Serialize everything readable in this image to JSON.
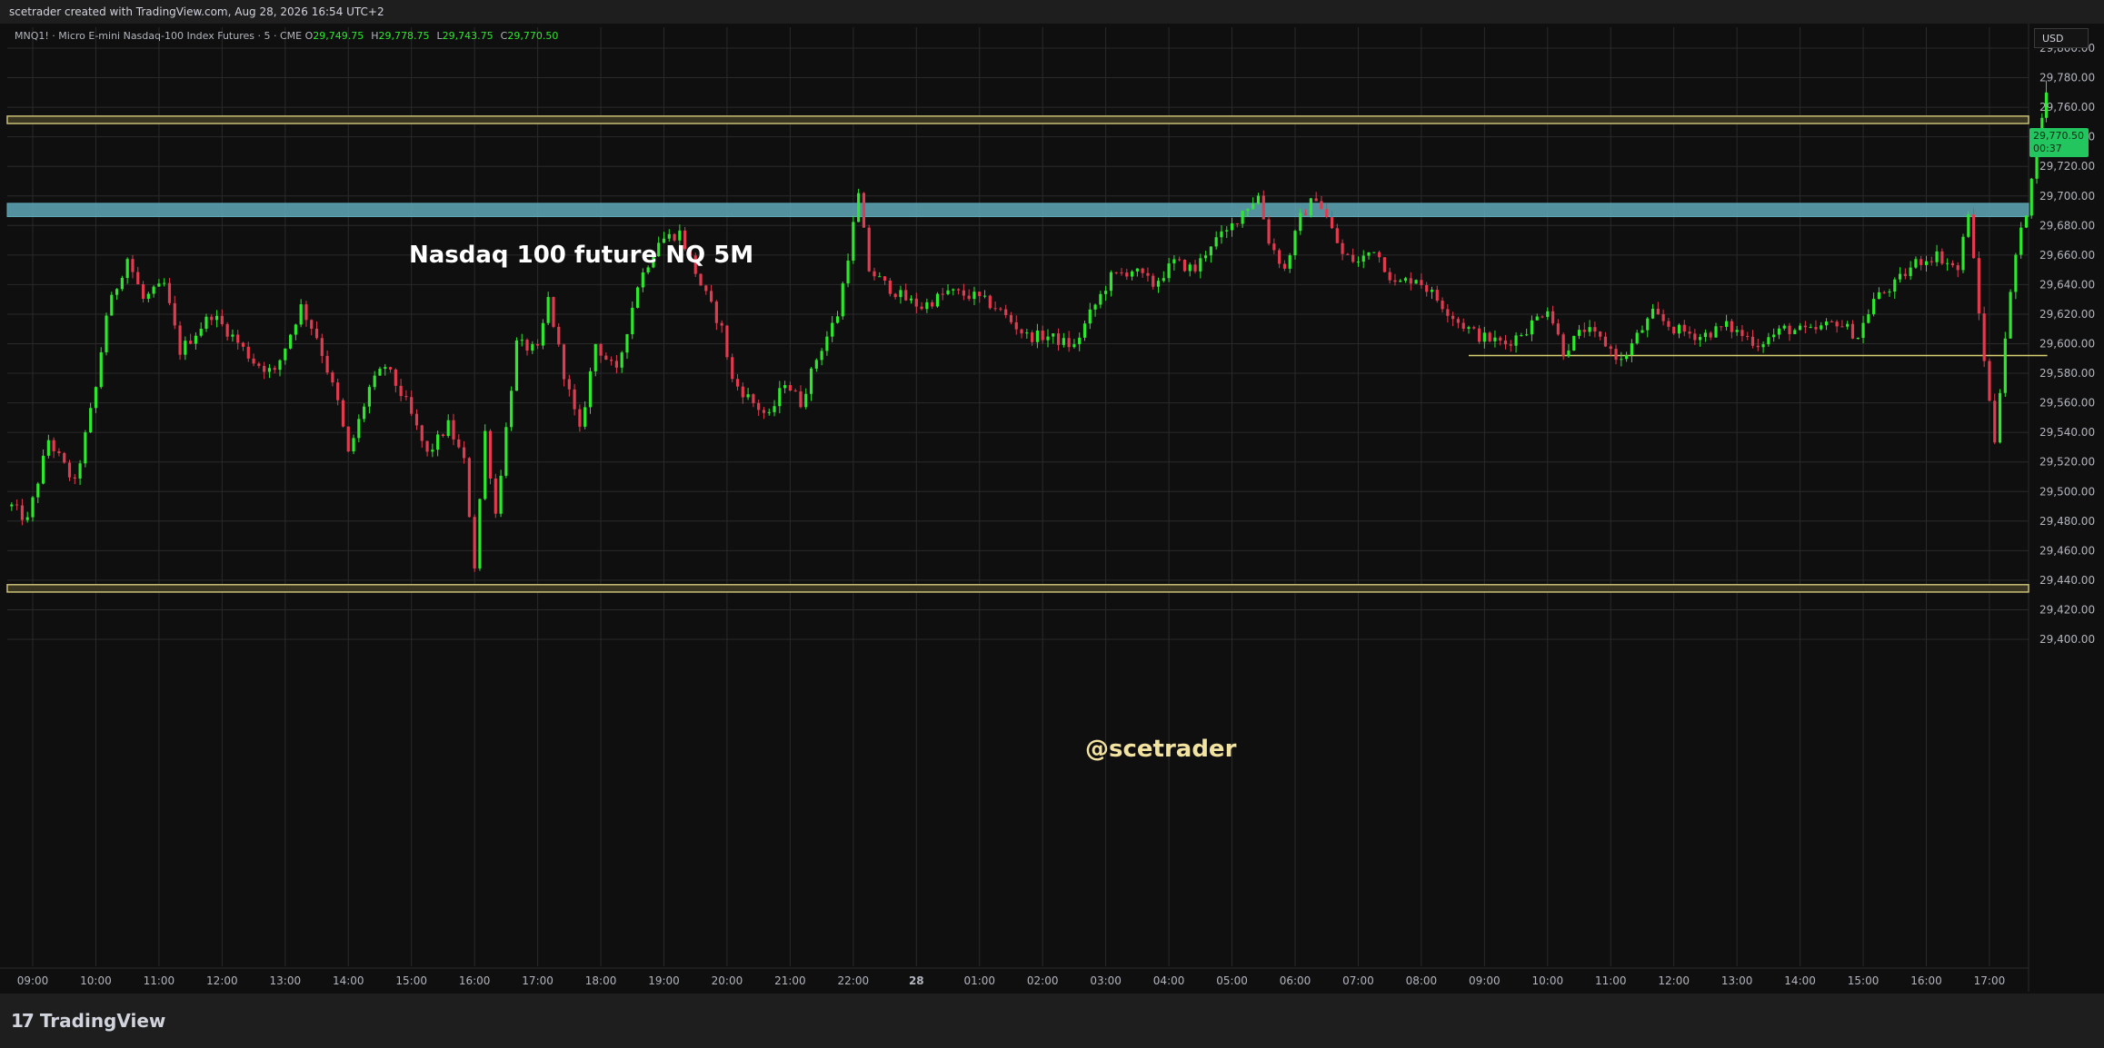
{
  "header": {
    "creator_line": "scetrader created with TradingView.com, Aug 28, 2026 16:54 UTC+2"
  },
  "symbol_legend": {
    "name": "MNQ1! · Micro E-mini Nasdaq-100 Index Futures · 5 · CME",
    "open_label": "O",
    "open": "29,749.75",
    "high_label": "H",
    "high": "29,778.75",
    "low_label": "L",
    "low": "29,743.75",
    "close_label": "C",
    "close": "29,770.50"
  },
  "currency_button": "USD",
  "last_price": {
    "price": "29,770.50",
    "countdown": "00:37"
  },
  "brand": "TradingView",
  "colors": {
    "bull": "#2ee82e",
    "bear": "#e23b4f",
    "background": "#0f0f0f",
    "grid": "#2a2a2a",
    "axis_text": "#b2b5be",
    "resistance_zone": "#5fa8b8",
    "level_band": "#c9bf76",
    "support_line": "#d8d070",
    "annotation_title": "#ffffff",
    "annotation_watermark": "#f3e3a0"
  },
  "chart_data": {
    "type": "candlestick",
    "title": "Nasdaq 100 future NQ 5M",
    "watermark": "@scetrader",
    "timeframe_minutes": 5,
    "y_axis": {
      "ylim": [
        29393,
        29820
      ],
      "ticks": [
        "29,800.00",
        "29,780.00",
        "29,760.00",
        "29,740.00",
        "29,720.00",
        "29,700.00",
        "29,680.00",
        "29,660.00",
        "29,640.00",
        "29,620.00",
        "29,600.00",
        "29,580.00",
        "29,560.00",
        "29,540.00",
        "29,520.00",
        "29,500.00",
        "29,480.00",
        "29,460.00",
        "29,440.00",
        "29,420.00",
        "29,400.00"
      ]
    },
    "x_axis": {
      "ticks": [
        "09:00",
        "10:00",
        "11:00",
        "12:00",
        "13:00",
        "14:00",
        "15:00",
        "16:00",
        "17:00",
        "18:00",
        "19:00",
        "20:00",
        "21:00",
        "22:00",
        "28",
        "01:00",
        "02:00",
        "03:00",
        "04:00",
        "05:00",
        "06:00",
        "07:00",
        "08:00",
        "09:00",
        "10:00",
        "11:00",
        "12:00",
        "13:00",
        "14:00",
        "15:00",
        "16:00",
        "17:00"
      ]
    },
    "horizontal_zones": [
      {
        "name": "upper-band",
        "low": 29749,
        "high": 29754,
        "style": "band"
      },
      {
        "name": "resistance-zone",
        "low": 29686,
        "high": 29695,
        "style": "zone"
      },
      {
        "name": "lower-band",
        "low": 29432,
        "high": 29437,
        "style": "band"
      }
    ],
    "support_line": {
      "price": 29592,
      "from": "07:45",
      "to": "16:55"
    },
    "price_path": [
      {
        "t": "08:40",
        "p": 29490
      },
      {
        "t": "08:55",
        "p": 29480
      },
      {
        "t": "09:15",
        "p": 29535
      },
      {
        "t": "09:40",
        "p": 29505
      },
      {
        "t": "10:00",
        "p": 29570
      },
      {
        "t": "10:10",
        "p": 29620
      },
      {
        "t": "10:30",
        "p": 29658
      },
      {
        "t": "10:45",
        "p": 29630
      },
      {
        "t": "11:05",
        "p": 29640
      },
      {
        "t": "11:20",
        "p": 29595
      },
      {
        "t": "11:50",
        "p": 29620
      },
      {
        "t": "12:10",
        "p": 29605
      },
      {
        "t": "12:30",
        "p": 29588
      },
      {
        "t": "12:50",
        "p": 29580
      },
      {
        "t": "13:15",
        "p": 29625
      },
      {
        "t": "13:30",
        "p": 29605
      },
      {
        "t": "13:50",
        "p": 29560
      },
      {
        "t": "14:00",
        "p": 29525
      },
      {
        "t": "14:20",
        "p": 29570
      },
      {
        "t": "14:35",
        "p": 29585
      },
      {
        "t": "14:55",
        "p": 29560
      },
      {
        "t": "15:15",
        "p": 29525
      },
      {
        "t": "15:35",
        "p": 29545
      },
      {
        "t": "15:50",
        "p": 29520
      },
      {
        "t": "16:00",
        "p": 29450
      },
      {
        "t": "16:10",
        "p": 29540
      },
      {
        "t": "16:20",
        "p": 29485
      },
      {
        "t": "16:40",
        "p": 29600
      },
      {
        "t": "17:00",
        "p": 29595
      },
      {
        "t": "17:10",
        "p": 29630
      },
      {
        "t": "17:25",
        "p": 29580
      },
      {
        "t": "17:40",
        "p": 29540
      },
      {
        "t": "17:55",
        "p": 29600
      },
      {
        "t": "18:15",
        "p": 29580
      },
      {
        "t": "18:35",
        "p": 29640
      },
      {
        "t": "18:55",
        "p": 29670
      },
      {
        "t": "19:15",
        "p": 29675
      },
      {
        "t": "19:35",
        "p": 29640
      },
      {
        "t": "19:55",
        "p": 29610
      },
      {
        "t": "20:05",
        "p": 29575
      },
      {
        "t": "20:25",
        "p": 29560
      },
      {
        "t": "20:40",
        "p": 29550
      },
      {
        "t": "20:55",
        "p": 29575
      },
      {
        "t": "21:10",
        "p": 29560
      },
      {
        "t": "21:25",
        "p": 29590
      },
      {
        "t": "21:45",
        "p": 29620
      },
      {
        "t": "21:55",
        "p": 29660
      },
      {
        "t": "22:05",
        "p": 29700
      },
      {
        "t": "22:15",
        "p": 29650
      },
      {
        "t": "22:30",
        "p": 29640
      },
      {
        "t": "22:50",
        "p": 29630
      },
      {
        "t": "23:05",
        "p": 29625
      },
      {
        "t": "23:30",
        "p": 29635
      },
      {
        "t": "23:55",
        "p": 29632
      },
      {
        "t": "00:15",
        "p": 29625
      },
      {
        "t": "00:30",
        "p": 29615
      },
      {
        "t": "00:45",
        "p": 29605
      },
      {
        "t": "01:05",
        "p": 29605
      },
      {
        "t": "01:30",
        "p": 29598
      },
      {
        "t": "01:45",
        "p": 29620
      },
      {
        "t": "02:05",
        "p": 29645
      },
      {
        "t": "02:25",
        "p": 29650
      },
      {
        "t": "02:45",
        "p": 29640
      },
      {
        "t": "03:05",
        "p": 29655
      },
      {
        "t": "03:25",
        "p": 29650
      },
      {
        "t": "03:40",
        "p": 29668
      },
      {
        "t": "03:55",
        "p": 29675
      },
      {
        "t": "04:10",
        "p": 29690
      },
      {
        "t": "04:25",
        "p": 29700
      },
      {
        "t": "04:35",
        "p": 29670
      },
      {
        "t": "04:50",
        "p": 29650
      },
      {
        "t": "05:05",
        "p": 29685
      },
      {
        "t": "05:20",
        "p": 29700
      },
      {
        "t": "05:30",
        "p": 29685
      },
      {
        "t": "05:45",
        "p": 29660
      },
      {
        "t": "06:00",
        "p": 29655
      },
      {
        "t": "06:15",
        "p": 29665
      },
      {
        "t": "06:35",
        "p": 29640
      },
      {
        "t": "06:55",
        "p": 29645
      },
      {
        "t": "07:15",
        "p": 29630
      },
      {
        "t": "07:35",
        "p": 29615
      },
      {
        "t": "07:55",
        "p": 29605
      },
      {
        "t": "08:20",
        "p": 29600
      },
      {
        "t": "08:40",
        "p": 29610
      },
      {
        "t": "09:00",
        "p": 29625
      },
      {
        "t": "09:15",
        "p": 29595
      },
      {
        "t": "09:35",
        "p": 29610
      },
      {
        "t": "09:55",
        "p": 29600
      },
      {
        "t": "10:10",
        "p": 29588
      },
      {
        "t": "10:25",
        "p": 29605
      },
      {
        "t": "10:40",
        "p": 29620
      },
      {
        "t": "11:00",
        "p": 29610
      },
      {
        "t": "11:25",
        "p": 29605
      },
      {
        "t": "11:50",
        "p": 29612
      },
      {
        "t": "12:20",
        "p": 29600
      },
      {
        "t": "12:45",
        "p": 29610
      },
      {
        "t": "13:10",
        "p": 29608
      },
      {
        "t": "13:35",
        "p": 29615
      },
      {
        "t": "13:55",
        "p": 29605
      },
      {
        "t": "14:10",
        "p": 29630
      },
      {
        "t": "14:30",
        "p": 29640
      },
      {
        "t": "14:50",
        "p": 29655
      },
      {
        "t": "15:10",
        "p": 29660
      },
      {
        "t": "15:30",
        "p": 29650
      },
      {
        "t": "15:40",
        "p": 29690
      },
      {
        "t": "15:50",
        "p": 29620
      },
      {
        "t": "16:00",
        "p": 29560
      },
      {
        "t": "16:05",
        "p": 29535
      },
      {
        "t": "16:15",
        "p": 29605
      },
      {
        "t": "16:25",
        "p": 29660
      },
      {
        "t": "16:35",
        "p": 29690
      },
      {
        "t": "16:45",
        "p": 29740
      },
      {
        "t": "16:54",
        "p": 29770
      }
    ]
  }
}
